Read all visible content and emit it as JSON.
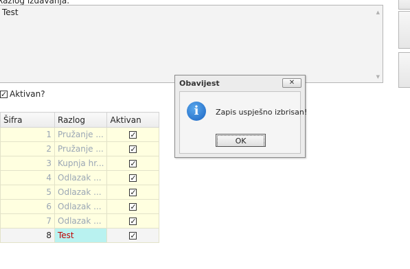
{
  "reason_field": {
    "label": "Razlog izdavanja:",
    "value": "Test"
  },
  "active_checkbox": {
    "label": "Aktivan?",
    "checked": true
  },
  "grid": {
    "columns": [
      "Šifra",
      "Razlog",
      "Aktivan"
    ],
    "rows": [
      {
        "sifra": "1",
        "razlog": "Pružanje ...",
        "aktivan": true
      },
      {
        "sifra": "2",
        "razlog": "Pružanje ...",
        "aktivan": true
      },
      {
        "sifra": "3",
        "razlog": "Kupnja hr...",
        "aktivan": true
      },
      {
        "sifra": "4",
        "razlog": "Odlazak ...",
        "aktivan": true
      },
      {
        "sifra": "5",
        "razlog": "Odlazak ...",
        "aktivan": true
      },
      {
        "sifra": "6",
        "razlog": "Odlazak ...",
        "aktivan": true
      },
      {
        "sifra": "7",
        "razlog": "Odlazak ...",
        "aktivan": true
      },
      {
        "sifra": "8",
        "razlog": "Test",
        "aktivan": true
      }
    ]
  },
  "dialog": {
    "title": "Obavijest",
    "close_glyph": "✕",
    "icon": "info-icon",
    "icon_glyph": "i",
    "message": "Zapis uspješno izbrisan!",
    "ok_label": "OK"
  },
  "check_glyph": "✓",
  "colors": {
    "row_bg": "#ffffe0",
    "selected_cell_bg": "#b9f2f0",
    "selected_text": "#c00000",
    "info_blue": "#1a64c2"
  }
}
